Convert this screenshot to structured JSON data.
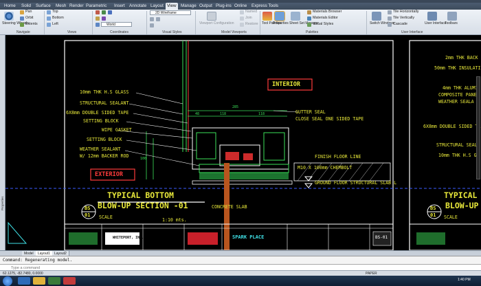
{
  "ribbon_tabs": [
    "Home",
    "Solid",
    "Surface",
    "Mesh",
    "Render",
    "Parametric",
    "Insert",
    "Annotate",
    "Layout",
    "View",
    "Manage",
    "Output",
    "Plug-ins",
    "Online",
    "Express Tools"
  ],
  "ribbon": {
    "steering_wheels": "Steering Wheels",
    "pan": "Pan",
    "orbit": "Orbit",
    "extents": "Extents",
    "top": "Top",
    "bottom": "Bottom",
    "left": "Left",
    "world": "World",
    "visual_style": "2D Wireframe",
    "named": "Named",
    "join": "Join",
    "restore": "Restore",
    "viewport_configuration": "Viewport Configuration",
    "tool_palettes": "Tool Palettes",
    "properties": "Properties",
    "sheet_set_manager": "Sheet Set Manager",
    "materials_browser": "Materials Browser",
    "materials_editor": "Materials Editor",
    "visual_styles": "Visual Styles",
    "switch_windows": "Switch Windows",
    "tile_horizontally": "Tile Horizontally",
    "tile_vertically": "Tile Vertically",
    "cascade": "Cascade",
    "user_interface": "User Interface",
    "toolbars": "Toolbars",
    "panels": [
      "Navigate",
      "Views",
      "Coordinates",
      "Visual Styles",
      "Model Viewports",
      "Palettes",
      "User Interface"
    ]
  },
  "side_palette_label": "Properties",
  "drawing": {
    "left_labels": [
      "10mm THK H.S GLASS",
      "STRUCTURAL SEALANT",
      "6X8mm DOUBLE SIDED TAPE",
      "SETTING BLOCK",
      "WIPE GASKET",
      "SETTING BLOCK",
      "WEATHER SEALANT",
      "W/ 12mm BACKER ROD"
    ],
    "interior": "INTERIOR",
    "exterior": "EXTERIOR",
    "right_labels": [
      "GUTTER SEAL",
      "CLOSE SEAL ONE SIDED TAPE"
    ],
    "finish_floor_line": "FINISH FLOOR LINE",
    "chembolt": "M10 X 100mm CHEMBOLT",
    "ground_floor_slab": "GROUND FLOOR STRUCTURAL SLAB L",
    "dims": [
      "285",
      "118",
      "118",
      "48",
      "100"
    ],
    "title_line1": "TYPICAL BOTTOM",
    "title_line2": "BLOW-UP SECTION -01",
    "concrete_slab": "CONCRETE SLAB",
    "bs_top": "BS",
    "bs_num": "01",
    "scale_label": "SCALE",
    "scale_value": "1:10 mts.",
    "project_name": "SPARK PLACE",
    "sheet_no": "BS-01",
    "company2": "WHITEPORT, INC.",
    "second_sheet": {
      "labels": [
        "2mm THK BACK",
        "50mm THK INSULATI",
        "4mm THK ALUMI",
        "COMPOSITE PANE",
        "WEATHER SEALA",
        "6X8mm DOUBLE SIDED TA",
        "STRUCTURAL SEALA",
        "10mm THK H.S GL",
        "TYPICAL",
        "BLOW-UP"
      ],
      "bs_top": "BS",
      "bs_num": "01",
      "scale_label": "SCALE"
    }
  },
  "layout_tabs": [
    "Model",
    "Layout1",
    "Layout2"
  ],
  "command_history": "Command: Regenerating model.",
  "command_placeholder": "Type a command",
  "status_coords": "62.1275, -82.7480, 0.0000",
  "status_paper": "PAPER",
  "clock": "1:40 PM"
}
